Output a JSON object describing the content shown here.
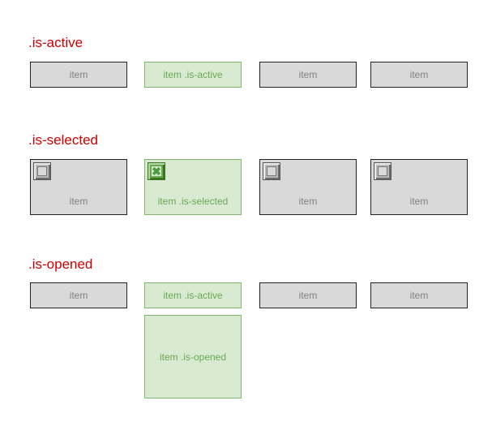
{
  "sections": {
    "active": {
      "heading": ".is-active",
      "items": [
        "item",
        "item .is-active",
        "item",
        "item"
      ]
    },
    "selected": {
      "heading": ".is-selected",
      "items": [
        "item",
        "item .is-selected",
        "item",
        "item"
      ],
      "checked": [
        false,
        true,
        false,
        false
      ]
    },
    "opened": {
      "heading": ".is-opened",
      "items": [
        "item",
        "item .is-active",
        "item",
        "item"
      ],
      "panel": "item .is-opened"
    }
  },
  "colors": {
    "heading": "#cc0000",
    "default_bg": "#d9d9d9",
    "active_bg": "#d9ead3",
    "active_border": "#7fb86a",
    "active_text": "#6aa84f"
  }
}
